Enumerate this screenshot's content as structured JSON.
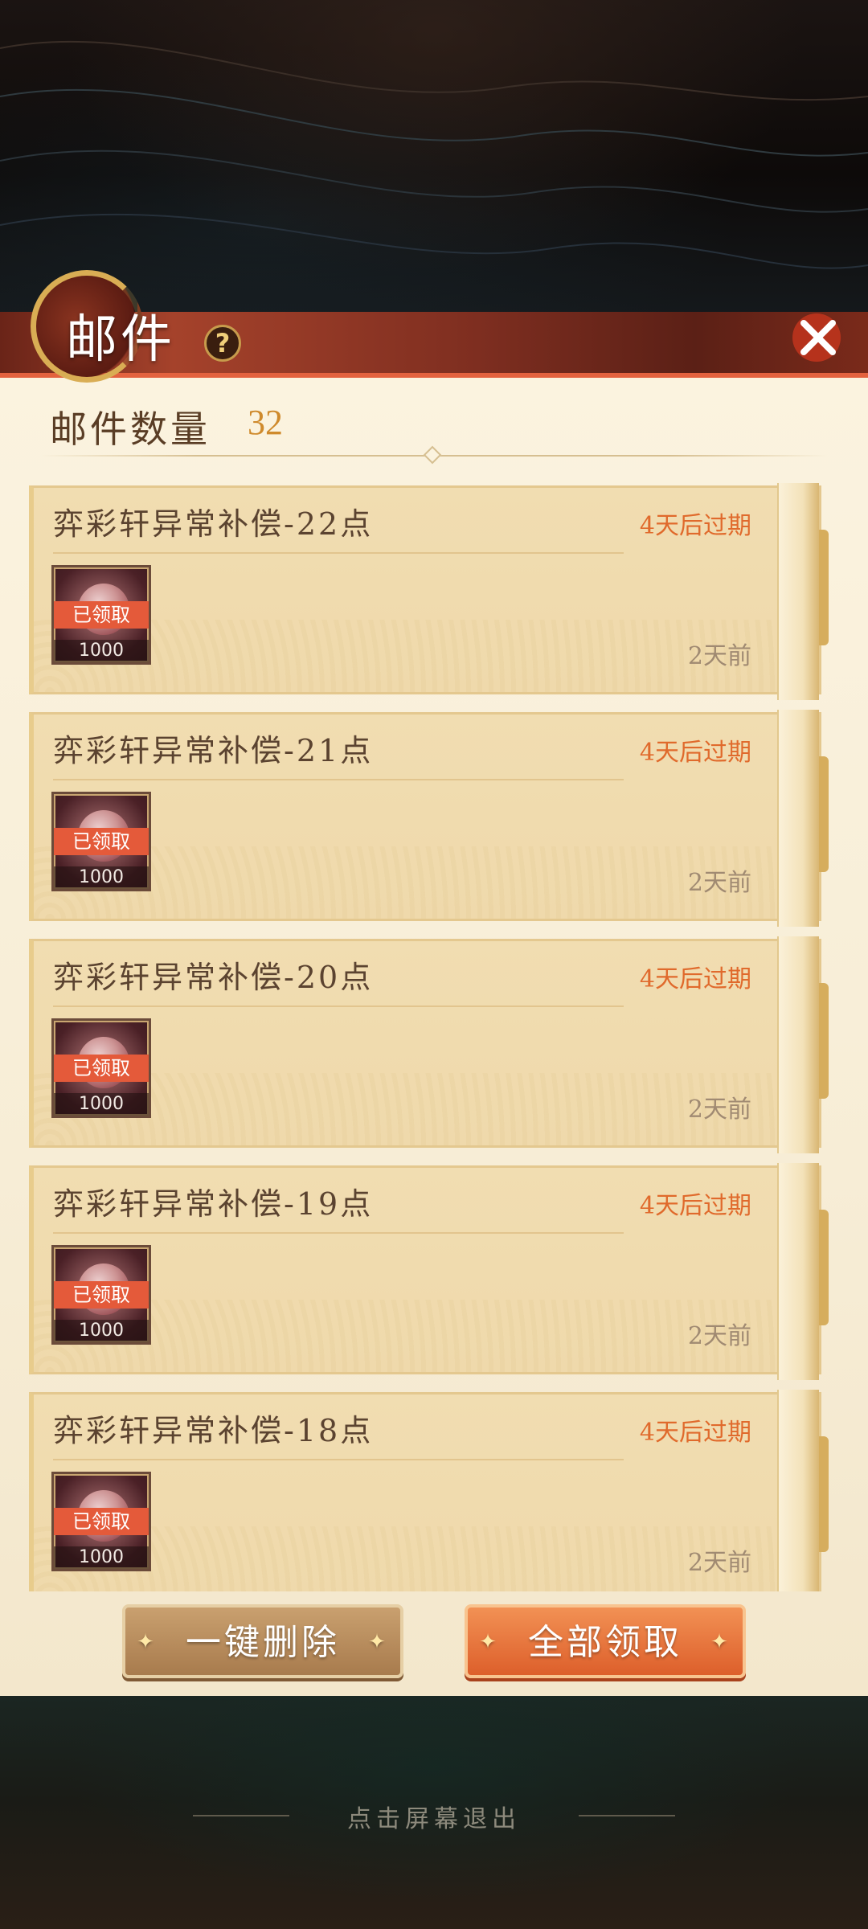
{
  "header": {
    "title": "邮件",
    "help_icon": "question-mark-icon",
    "close_icon": "close-x-icon"
  },
  "summary": {
    "count_label": "邮件数量",
    "count_value": "32"
  },
  "mails": [
    {
      "title": "弈彩轩异常补偿-22点",
      "expire": "4天后过期",
      "time": "2天前",
      "item_status": "已领取",
      "item_qty": "1000"
    },
    {
      "title": "弈彩轩异常补偿-21点",
      "expire": "4天后过期",
      "time": "2天前",
      "item_status": "已领取",
      "item_qty": "1000"
    },
    {
      "title": "弈彩轩异常补偿-20点",
      "expire": "4天后过期",
      "time": "2天前",
      "item_status": "已领取",
      "item_qty": "1000"
    },
    {
      "title": "弈彩轩异常补偿-19点",
      "expire": "4天后过期",
      "time": "2天前",
      "item_status": "已领取",
      "item_qty": "1000"
    },
    {
      "title": "弈彩轩异常补偿-18点",
      "expire": "4天后过期",
      "time": "2天前",
      "item_status": "已领取",
      "item_qty": "1000"
    }
  ],
  "actions": {
    "delete_all": "一键删除",
    "claim_all": "全部领取"
  },
  "footer": {
    "exit_hint": "点击屏幕退出"
  },
  "colors": {
    "accent_orange": "#e06a2c",
    "count_gold": "#cf8a2c",
    "title_bar": "#a5422b",
    "claimed_badge": "#e45a3a"
  }
}
